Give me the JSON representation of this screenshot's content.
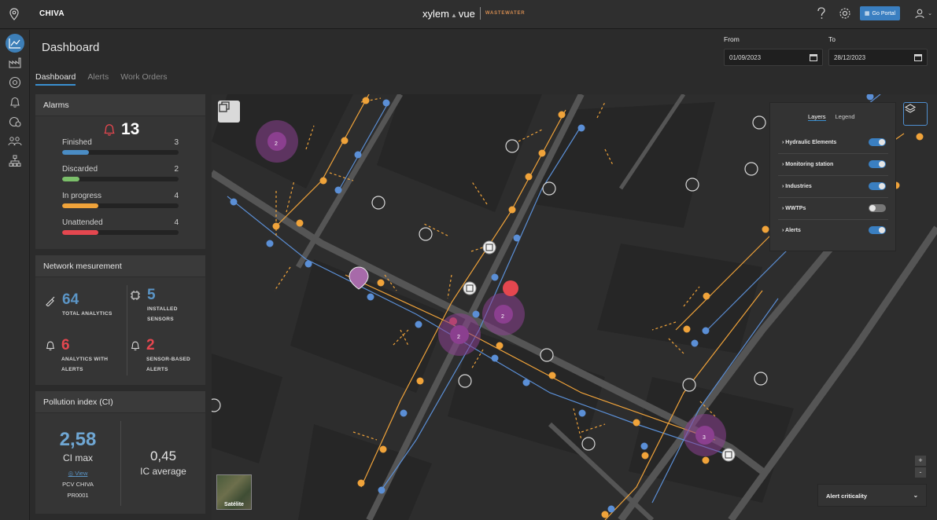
{
  "header": {
    "site_name": "CHIVA",
    "brand": "xylem",
    "product": "vue",
    "segment": "WASTEWATER",
    "go_portal_label": "Go Portal",
    "icons": [
      "help-icon",
      "settings-icon",
      "user-icon"
    ]
  },
  "sidebar": {
    "items": [
      {
        "name": "dashboard",
        "icon": "line-chart-icon",
        "active": true
      },
      {
        "name": "industries",
        "icon": "factory-icon"
      },
      {
        "name": "monitoring",
        "icon": "target-icon"
      },
      {
        "name": "alerts",
        "icon": "bell-icon"
      },
      {
        "name": "analytics",
        "icon": "gauge-icon"
      },
      {
        "name": "users",
        "icon": "users-icon"
      },
      {
        "name": "network",
        "icon": "hierarchy-icon"
      }
    ]
  },
  "page": {
    "title": "Dashboard",
    "tabs": [
      {
        "label": "Dashboard",
        "active": true
      },
      {
        "label": "Alerts",
        "active": false
      },
      {
        "label": "Work Orders",
        "active": false
      }
    ],
    "from_label": "From",
    "from_value": "01/09/2023",
    "to_label": "To",
    "to_value": "28/12/2023"
  },
  "alarms": {
    "title": "Alarms",
    "total": "13",
    "rows": [
      {
        "label": "Finished",
        "count": "3",
        "fraction": 0.23,
        "color": "#4a8cc4"
      },
      {
        "label": "Discarded",
        "count": "2",
        "fraction": 0.15,
        "color": "#7bbf6a"
      },
      {
        "label": "In progress",
        "count": "4",
        "fraction": 0.31,
        "color": "#f0a33a"
      },
      {
        "label": "Unattended",
        "count": "4",
        "fraction": 0.31,
        "color": "#e4474f"
      }
    ]
  },
  "network": {
    "title": "Network mesurement",
    "total_analytics": "64",
    "total_analytics_label_1": "TOTAL ANALYTICS",
    "installed_sensors": "5",
    "installed_sensors_label_1": "INSTALLED",
    "installed_sensors_label_2": "SENSORS",
    "analytics_alerts": "6",
    "analytics_alerts_label_1": "ANALYTICS WITH",
    "analytics_alerts_label_2": "ALERTS",
    "sensor_alerts": "2",
    "sensor_alerts_label_1": "SENSOR-BASED",
    "sensor_alerts_label_2": "ALERTS",
    "blue": "#5b95c6",
    "red": "#e4474f"
  },
  "pollution": {
    "title": "Pollution index (CI)",
    "ci_max": "2,58",
    "ci_max_label": "CI max",
    "view_label": "View",
    "station": "PCV CHIVA",
    "station_code": "PR0001",
    "ic_average": "0,45",
    "ic_average_label": "IC average"
  },
  "map": {
    "layers_panel": {
      "tabs": [
        {
          "label": "Layers",
          "active": true
        },
        {
          "label": "Legend",
          "active": false
        }
      ],
      "layers": [
        {
          "label": "Hydraulic Elements",
          "on": true
        },
        {
          "label": "Monitoring station",
          "on": true
        },
        {
          "label": "Industries",
          "on": true
        },
        {
          "label": "WWTPs",
          "on": false
        },
        {
          "label": "Alerts",
          "on": true
        }
      ]
    },
    "clusters": [
      {
        "count": "2"
      },
      {
        "count": "2"
      },
      {
        "count": "2"
      },
      {
        "count": "3"
      }
    ],
    "satellite_label": "Satélite",
    "alert_criticality_label": "Alert criticality",
    "zoom_in": "+",
    "zoom_out": "-",
    "colors": {
      "orange": "#f0a33a",
      "blue": "#5b8fd6",
      "purple": "#8b3f8f",
      "road": "#555555"
    }
  }
}
